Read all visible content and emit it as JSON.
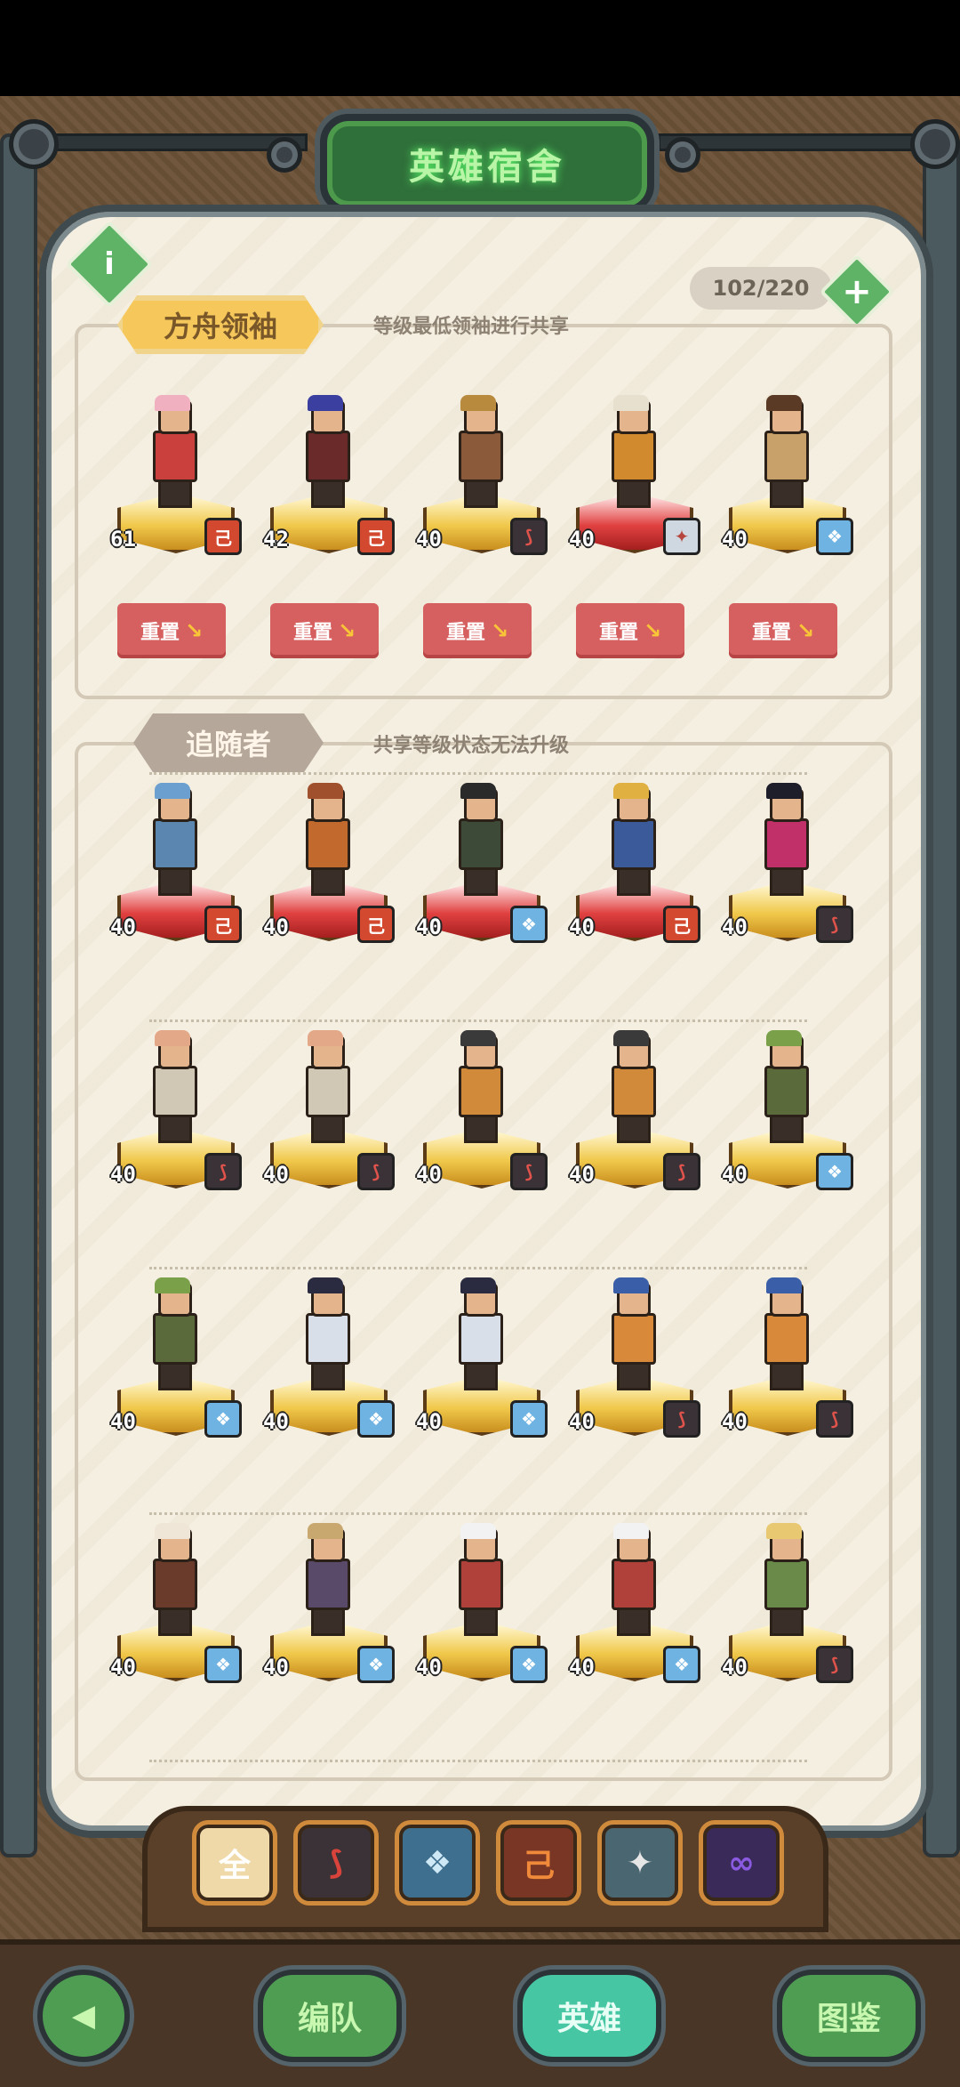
{
  "title": "英雄宿舍",
  "info_icon": "i",
  "counter": "102/220",
  "plus_icon": "+",
  "leaders": {
    "tag": "方舟领袖",
    "subtitle": "等级最低领袖进行共享",
    "reset_label": "重置",
    "heroes": [
      {
        "level": "61",
        "class": "fire",
        "hair": "#f0b0c0",
        "outfit": "#c9403c",
        "pedestal": "gold"
      },
      {
        "level": "42",
        "class": "fire",
        "hair": "#3a3fa0",
        "outfit": "#6b2a2a",
        "pedestal": "gold"
      },
      {
        "level": "40",
        "class": "blade",
        "hair": "#b88a3e",
        "outfit": "#8b5a3a",
        "pedestal": "gold"
      },
      {
        "level": "40",
        "class": "feather",
        "hair": "#e8e0cf",
        "outfit": "#d28a2e",
        "pedestal": "red"
      },
      {
        "level": "40",
        "class": "wolf",
        "hair": "#5a3a24",
        "outfit": "#c7a06a",
        "pedestal": "gold"
      }
    ]
  },
  "followers": {
    "tag": "追随者",
    "subtitle": "共享等级状态无法升级",
    "rows": [
      [
        {
          "level": "40",
          "class": "fire",
          "hair": "#6a9fd0",
          "outfit": "#5a86b0",
          "pedestal": "red"
        },
        {
          "level": "40",
          "class": "fire",
          "hair": "#a0502c",
          "outfit": "#c2692e",
          "pedestal": "red"
        },
        {
          "level": "40",
          "class": "wolf",
          "hair": "#2a2a2a",
          "outfit": "#3e4a38",
          "pedestal": "red"
        },
        {
          "level": "40",
          "class": "fire",
          "hair": "#e0b040",
          "outfit": "#3a5a9a",
          "pedestal": "red"
        },
        {
          "level": "40",
          "class": "blade",
          "hair": "#1e1e2a",
          "outfit": "#c2306a",
          "pedestal": "gold"
        }
      ],
      [
        {
          "level": "40",
          "class": "blade",
          "hair": "#e3a888",
          "outfit": "#d0c7b5",
          "pedestal": "gold"
        },
        {
          "level": "40",
          "class": "blade",
          "hair": "#e3a888",
          "outfit": "#d0c7b5",
          "pedestal": "gold"
        },
        {
          "level": "40",
          "class": "blade",
          "hair": "#3a3a3a",
          "outfit": "#d08a3a",
          "pedestal": "gold"
        },
        {
          "level": "40",
          "class": "blade",
          "hair": "#3a3a3a",
          "outfit": "#d08a3a",
          "pedestal": "gold"
        },
        {
          "level": "40",
          "class": "wolf",
          "hair": "#7aa04a",
          "outfit": "#5a6a3a",
          "pedestal": "gold"
        }
      ],
      [
        {
          "level": "40",
          "class": "wolf",
          "hair": "#7aa04a",
          "outfit": "#5a6a3a",
          "pedestal": "gold"
        },
        {
          "level": "40",
          "class": "wolf",
          "hair": "#2a2a40",
          "outfit": "#d8dfe8",
          "pedestal": "gold"
        },
        {
          "level": "40",
          "class": "wolf",
          "hair": "#2a2a40",
          "outfit": "#d8dfe8",
          "pedestal": "gold"
        },
        {
          "level": "40",
          "class": "blade",
          "hair": "#3a5fa8",
          "outfit": "#d88a3a",
          "pedestal": "gold"
        },
        {
          "level": "40",
          "class": "blade",
          "hair": "#3a5fa8",
          "outfit": "#d88a3a",
          "pedestal": "gold"
        }
      ],
      [
        {
          "level": "40",
          "class": "wolf",
          "hair": "#f0e6d8",
          "outfit": "#6a3a2a",
          "pedestal": "gold"
        },
        {
          "level": "40",
          "class": "wolf",
          "hair": "#c9a870",
          "outfit": "#5a4a6a",
          "pedestal": "gold"
        },
        {
          "level": "40",
          "class": "wolf",
          "hair": "#f2f2f2",
          "outfit": "#b0403a",
          "pedestal": "gold"
        },
        {
          "level": "40",
          "class": "wolf",
          "hair": "#f2f2f2",
          "outfit": "#b0403a",
          "pedestal": "gold"
        },
        {
          "level": "40",
          "class": "blade",
          "hair": "#e8c870",
          "outfit": "#6a8a4a",
          "pedestal": "gold"
        }
      ]
    ]
  },
  "class_glyphs": {
    "fire": "己",
    "blade": "⟆",
    "wolf": "❖",
    "feather": "✦"
  },
  "filters": [
    {
      "name": "all",
      "glyph": "全",
      "bg": "#f0d9a8",
      "color": "#ffffff"
    },
    {
      "name": "blade",
      "glyph": "⟆",
      "bg": "#3a3236",
      "color": "#d8443c"
    },
    {
      "name": "wolf",
      "glyph": "❖",
      "bg": "#3f6f8f",
      "color": "#cfe8f5"
    },
    {
      "name": "fire",
      "glyph": "己",
      "bg": "#7a3624",
      "color": "#f08a3a"
    },
    {
      "name": "feather",
      "glyph": "✦",
      "bg": "#4a6670",
      "color": "#e6e6e6"
    },
    {
      "name": "infinity",
      "glyph": "∞",
      "bg": "#3a2a5a",
      "color": "#8a5ae0"
    }
  ],
  "nav": {
    "back": "◀",
    "team": "编队",
    "heroes": "英雄",
    "codex": "图鉴"
  }
}
